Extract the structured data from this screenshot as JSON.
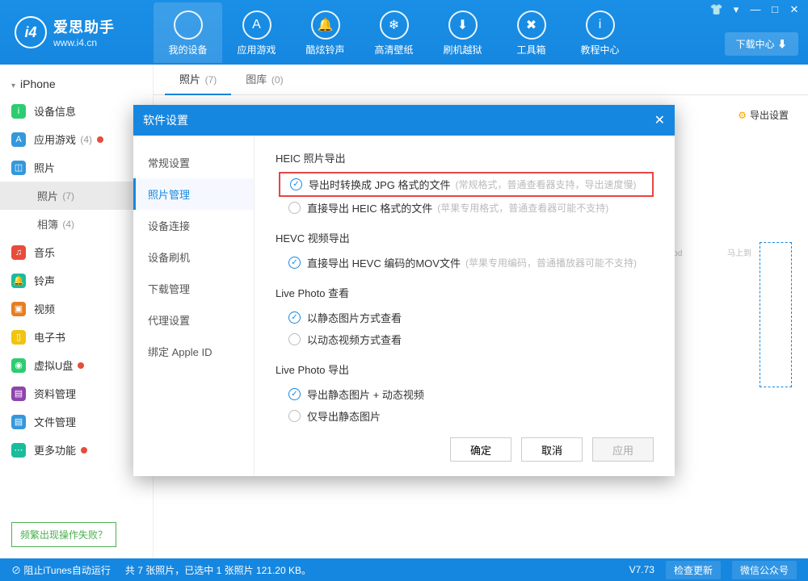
{
  "app": {
    "title": "爱思助手",
    "url": "www.i4.cn",
    "logo_glyph": "i4"
  },
  "winctrl": {
    "skin": "👕",
    "sep": "▾",
    "min": "—",
    "max": "□",
    "close": "✕"
  },
  "download_center": "下载中心 ⬇",
  "nav": [
    {
      "label": "我的设备",
      "glyph": "",
      "active": true
    },
    {
      "label": "应用游戏",
      "glyph": "A"
    },
    {
      "label": "酷炫铃声",
      "glyph": "🔔"
    },
    {
      "label": "高清壁纸",
      "glyph": "❄"
    },
    {
      "label": "刷机越狱",
      "glyph": "⬇"
    },
    {
      "label": "工具箱",
      "glyph": "✖"
    },
    {
      "label": "教程中心",
      "glyph": "i"
    }
  ],
  "device": "iPhone",
  "sidebar": [
    {
      "label": "设备信息",
      "color": "#2ecc71",
      "glyph": "i"
    },
    {
      "label": "应用游戏",
      "color": "#3498db",
      "glyph": "A",
      "count": "(4)",
      "dot": true
    },
    {
      "label": "照片",
      "color": "#3498db",
      "glyph": "◫"
    },
    {
      "label": "照片",
      "sub": true,
      "count": "(7)",
      "sel": true
    },
    {
      "label": "相簿",
      "sub": true,
      "count": "(4)"
    },
    {
      "label": "音乐",
      "color": "#e74c3c",
      "glyph": "♫"
    },
    {
      "label": "铃声",
      "color": "#1abc9c",
      "glyph": "🔔"
    },
    {
      "label": "视频",
      "color": "#e67e22",
      "glyph": "▣"
    },
    {
      "label": "电子书",
      "color": "#f1c40f",
      "glyph": "▯"
    },
    {
      "label": "虚拟U盘",
      "color": "#2ecc71",
      "glyph": "◉",
      "dot": true
    },
    {
      "label": "资料管理",
      "color": "#8e44ad",
      "glyph": "▤"
    },
    {
      "label": "文件管理",
      "color": "#3498db",
      "glyph": "▤"
    },
    {
      "label": "更多功能",
      "color": "#1abc9c",
      "glyph": "⋯",
      "dot": true
    }
  ],
  "fail_hint": "频繁出现操作失败？",
  "tabs": [
    {
      "label": "照片",
      "count": "(7)",
      "active": true
    },
    {
      "label": "图库",
      "count": "(0)"
    }
  ],
  "export_settings": "导出设置",
  "placeholder": {
    "left": "mod",
    "right": "马上到"
  },
  "modal": {
    "title": "软件设置",
    "side": [
      "常规设置",
      "照片管理",
      "设备连接",
      "设备刷机",
      "下载管理",
      "代理设置",
      "绑定 Apple ID"
    ],
    "side_active": 1,
    "sections": [
      {
        "title": "HEIC 照片导出",
        "options": [
          {
            "text": "导出时转换成 JPG 格式的文件",
            "hint": "(常规格式，普通查看器支持，导出速度慢)",
            "checked": true,
            "highlight": true
          },
          {
            "text": "直接导出 HEIC 格式的文件",
            "hint": "(苹果专用格式，普通查看器可能不支持)",
            "checked": false
          }
        ]
      },
      {
        "title": "HEVC 视频导出",
        "options": [
          {
            "text": "直接导出 HEVC 编码的MOV文件",
            "hint": "(苹果专用编码，普通播放器可能不支持)",
            "checked": true
          }
        ]
      },
      {
        "title": "Live Photo 查看",
        "options": [
          {
            "text": "以静态图片方式查看",
            "checked": true
          },
          {
            "text": "以动态视频方式查看",
            "checked": false
          }
        ]
      },
      {
        "title": "Live Photo 导出",
        "options": [
          {
            "text": "导出静态图片 + 动态视频",
            "checked": true
          },
          {
            "text": "仅导出静态图片",
            "checked": false
          }
        ]
      }
    ],
    "buttons": {
      "ok": "确定",
      "cancel": "取消",
      "apply": "应用"
    }
  },
  "statusbar": {
    "itunes": "阻止iTunes自动运行",
    "summary": "共 7 张照片，已选中 1 张照片 121.20 KB。",
    "version": "V7.73",
    "check": "检查更新",
    "wechat": "微信公众号"
  }
}
